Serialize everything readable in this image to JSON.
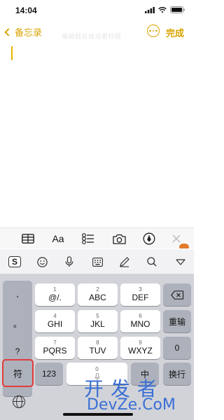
{
  "status_bar": {
    "time": "14:04"
  },
  "nav": {
    "back_label": "备忘录",
    "done_label": "完成",
    "faint_text": "编辑题目或设置标题"
  },
  "format_toolbar": {
    "text_style_label": "Aa"
  },
  "keyboard": {
    "punct": [
      ",",
      "。",
      "?",
      "!"
    ],
    "rows": [
      [
        {
          "sub": "1",
          "main": "@/."
        },
        {
          "sub": "2",
          "main": "ABC"
        },
        {
          "sub": "3",
          "main": "DEF"
        }
      ],
      [
        {
          "sub": "4",
          "main": "GHI"
        },
        {
          "sub": "5",
          "main": "JKL"
        },
        {
          "sub": "6",
          "main": "MNO"
        }
      ],
      [
        {
          "sub": "7",
          "main": "PQRS"
        },
        {
          "sub": "8",
          "main": "TUV"
        },
        {
          "sub": "9",
          "main": "WXYZ"
        }
      ]
    ],
    "retype_label": "重输",
    "zero_label": "0",
    "symbol_label": "符",
    "numbers_label": "123",
    "space_sub": "0",
    "cn_en_label": "中",
    "newline_label": "换行"
  },
  "watermark": {
    "cn": "开发者",
    "en": "DevZe.CoM"
  },
  "colors": {
    "accent": "#d9a400",
    "highlight": "#e33a3a",
    "keyboard_bg": "#d1d3d9"
  }
}
